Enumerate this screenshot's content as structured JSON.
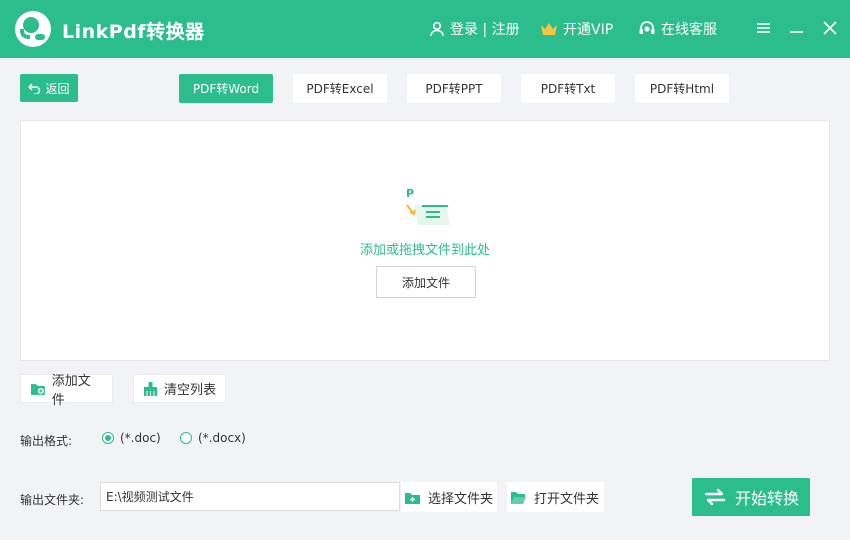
{
  "app": {
    "title": "LinkPdf转换器",
    "login_label": "登录 | 注册",
    "vip_label": "开通VIP",
    "service_label": "在线客服",
    "accent_color": "#2bbd8c",
    "vip_color": "#f6c544"
  },
  "toolbar": {
    "back_label": "返回",
    "tabs": [
      {
        "label": "PDF转Word",
        "active": true
      },
      {
        "label": "PDF转Excel",
        "active": false
      },
      {
        "label": "PDF转PPT",
        "active": false
      },
      {
        "label": "PDF转Txt",
        "active": false
      },
      {
        "label": "PDF转Html",
        "active": false
      }
    ]
  },
  "dropzone": {
    "hint": "添加或拖拽文件到此处",
    "add_button": "添加文件",
    "icon_letter": "P"
  },
  "actions": {
    "add_files": "添加文件",
    "clear_list": "清空列表"
  },
  "output_format": {
    "label": "输出格式:",
    "options": [
      {
        "label": "(*.doc)",
        "checked": true
      },
      {
        "label": "(*.docx)",
        "checked": false
      }
    ]
  },
  "output_folder": {
    "label": "输出文件夹:",
    "value": "E:\\视频测试文件",
    "choose_label": "选择文件夹",
    "open_label": "打开文件夹"
  },
  "start_label": "开始转换"
}
